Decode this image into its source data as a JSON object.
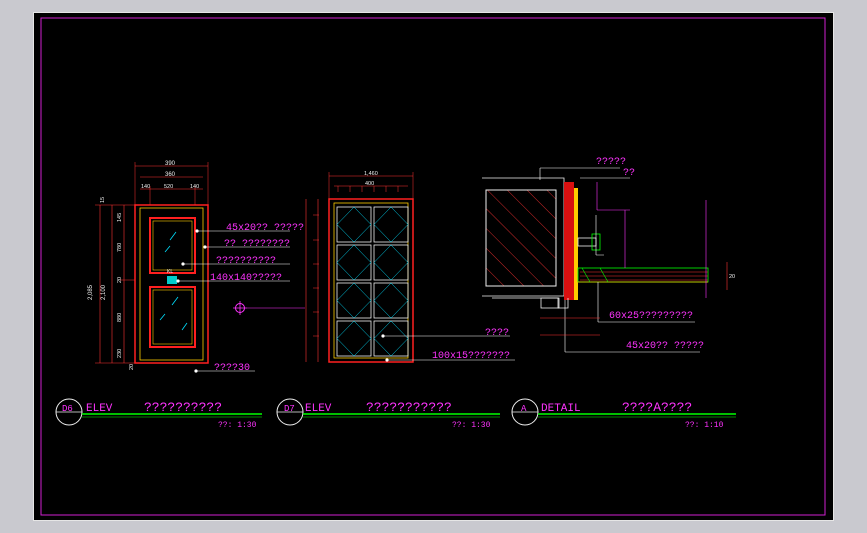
{
  "door_d6": {
    "dims_top": [
      "390",
      "360",
      "140",
      "520",
      "140"
    ],
    "dims_left": [
      "2,085",
      "2,100",
      "15",
      "145",
      "780",
      "20",
      "880",
      "230",
      "20"
    ],
    "notes": [
      "45x20?? ?????",
      "?? ????????",
      "??????????",
      "140x140?????",
      "????30"
    ],
    "tag": "D6",
    "view": "ELEV",
    "title": "??????????",
    "scale": "??: 1:30"
  },
  "door_d7": {
    "dims_top": [
      "1,460",
      "400"
    ],
    "notes": [
      "????",
      "100x15???????"
    ],
    "tag": "D7",
    "view": "ELEV",
    "title": "???????????",
    "scale": "??: 1:30"
  },
  "detail_a": {
    "notes": [
      "?????",
      "??",
      "60x25?????????",
      "45x20?? ?????"
    ],
    "tag": "A",
    "view": "DETAIL",
    "title": "????A????",
    "scale": "??: 1:10"
  }
}
